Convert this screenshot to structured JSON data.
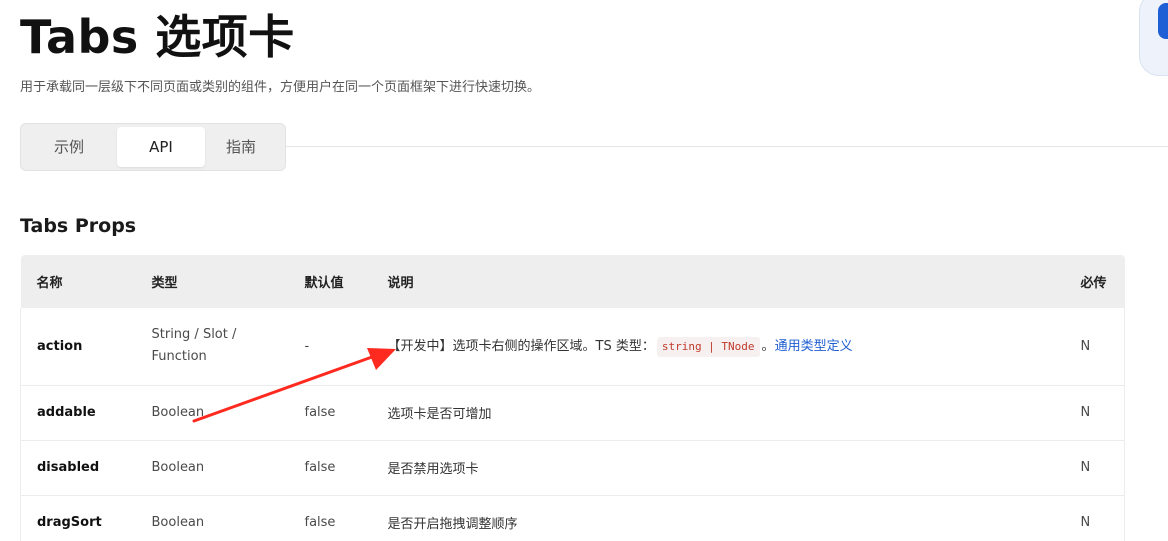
{
  "header": {
    "title": "Tabs 选项卡",
    "description": "用于承载同一层级下不同页面或类别的组件，方便用户在同一个页面框架下进行快速切换。"
  },
  "tabs": [
    {
      "label": "示例",
      "active": false
    },
    {
      "label": "API",
      "active": true
    },
    {
      "label": "指南",
      "active": false
    }
  ],
  "section": {
    "title": "Tabs Props"
  },
  "table": {
    "columns": [
      "名称",
      "类型",
      "默认值",
      "说明",
      "必传"
    ],
    "rows": [
      {
        "name": "action",
        "type": "String / Slot / Function",
        "default": "-",
        "description": {
          "prefix": "【开发中】选项卡右侧的操作区域。TS 类型：",
          "code": "string | TNode",
          "suffix": "。",
          "link": "通用类型定义"
        },
        "required": "N"
      },
      {
        "name": "addable",
        "type": "Boolean",
        "default": "false",
        "description": {
          "prefix": "选项卡是否可增加"
        },
        "required": "N"
      },
      {
        "name": "disabled",
        "type": "Boolean",
        "default": "false",
        "description": {
          "prefix": "是否禁用选项卡"
        },
        "required": "N"
      },
      {
        "name": "dragSort",
        "type": "Boolean",
        "default": "false",
        "description": {
          "prefix": "是否开启拖拽调整顺序"
        },
        "required": "N"
      }
    ]
  },
  "annotation": {
    "color": "#ff2a1f"
  },
  "colors": {
    "accent_link": "#1f5fd1",
    "code_text": "#c0392b",
    "header_bg": "#eeeeee"
  }
}
